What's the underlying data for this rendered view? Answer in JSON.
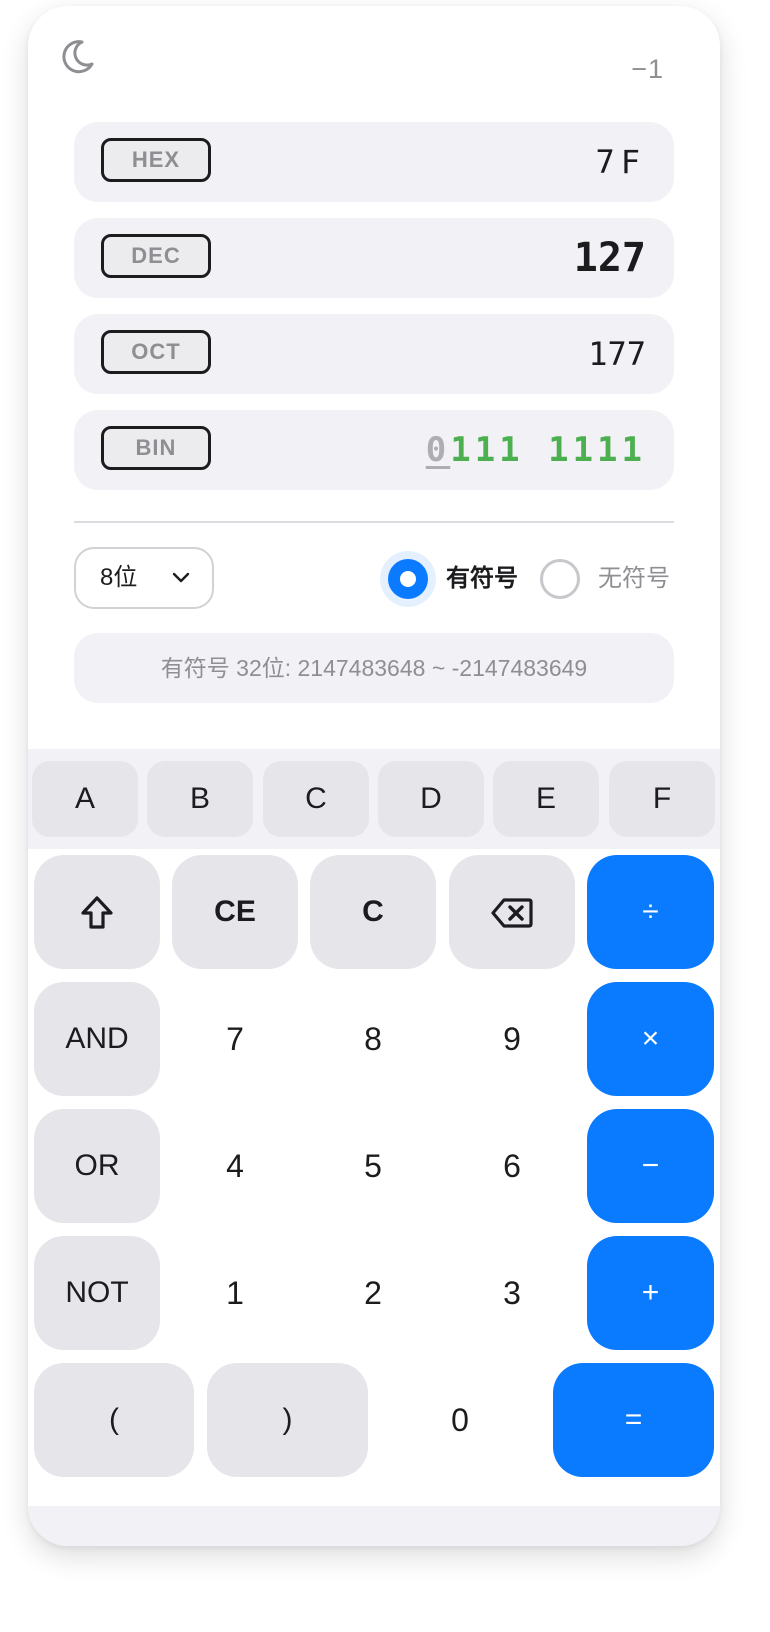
{
  "header": {
    "theme_icon": "moon-icon",
    "expression": "−1"
  },
  "radix": [
    {
      "tag": "HEX",
      "value": "7F",
      "active": false
    },
    {
      "tag": "DEC",
      "value": "127",
      "active": true
    },
    {
      "tag": "OCT",
      "value": "177",
      "active": false
    },
    {
      "tag": "BIN",
      "value_lead": "0",
      "value_rest": "111 1111",
      "active": false
    }
  ],
  "controls": {
    "bits_selected": "8位",
    "signed_label": "有符号",
    "unsigned_label": "无符号",
    "signed_checked": true,
    "range_text": "有符号 32位: 2147483648 ~ -2147483649"
  },
  "hex_keys": [
    "A",
    "B",
    "C",
    "D",
    "E",
    "F"
  ],
  "keypad": {
    "row1": {
      "shift_icon": "shift-icon",
      "ce": "CE",
      "c": "C",
      "backspace_icon": "backspace-icon",
      "divide": "÷"
    },
    "row2": {
      "op": "AND",
      "k1": "7",
      "k2": "8",
      "k3": "9",
      "multiply": "×"
    },
    "row3": {
      "op": "OR",
      "k1": "4",
      "k2": "5",
      "k3": "6",
      "minus": "−"
    },
    "row4": {
      "op": "NOT",
      "k1": "1",
      "k2": "2",
      "k3": "3",
      "plus": "+"
    },
    "row5": {
      "lparen": "(",
      "rparen": ")",
      "zero": "0",
      "equals": "="
    }
  },
  "colors": {
    "accent": "#0a7aff",
    "binary_ones": "#4caf50",
    "key_gray": "#e5e5ea",
    "panel": "#f2f2f6"
  }
}
